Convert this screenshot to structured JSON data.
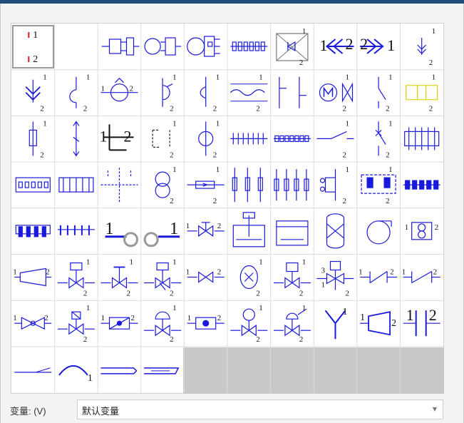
{
  "variable": {
    "label": "变量: (V)",
    "value": "默认变量"
  },
  "symbols": [
    {
      "name": "sym-connector-pins",
      "labels": [
        "1",
        "2"
      ]
    },
    {
      "name": "sym-empty",
      "labels": []
    },
    {
      "name": "sym-plug-socket",
      "labels": []
    },
    {
      "name": "sym-socket-circle",
      "labels": []
    },
    {
      "name": "sym-plug-multi",
      "labels": []
    },
    {
      "name": "sym-terminal-strip",
      "labels": []
    },
    {
      "name": "sym-diode-box",
      "labels": [
        "1",
        "2"
      ]
    },
    {
      "name": "sym-arrow-left",
      "labels": [
        "1",
        "2"
      ]
    },
    {
      "name": "sym-arrow-right",
      "labels": [
        "2",
        "1"
      ]
    },
    {
      "name": "sym-arrow-down-small",
      "labels": [
        "1",
        "2"
      ]
    },
    {
      "name": "sym-antenna-down",
      "labels": [
        "1",
        "2"
      ]
    },
    {
      "name": "sym-hook",
      "labels": [
        "1",
        "2"
      ]
    },
    {
      "name": "sym-sensor-circle",
      "labels": [
        "1",
        "2"
      ]
    },
    {
      "name": "sym-sensor-half",
      "labels": [
        "1",
        "2"
      ]
    },
    {
      "name": "sym-hook-line",
      "labels": [
        "1",
        "2"
      ]
    },
    {
      "name": "sym-wave-lines",
      "labels": [
        "1",
        "2"
      ]
    },
    {
      "name": "sym-bracket-lines",
      "labels": []
    },
    {
      "name": "sym-motor-valve",
      "labels": [
        "1",
        "2"
      ]
    },
    {
      "name": "sym-switch-slash",
      "labels": [
        "1",
        "2"
      ]
    },
    {
      "name": "sym-yellow-block",
      "labels": [
        "1",
        "2"
      ]
    },
    {
      "name": "sym-fuse-vertical",
      "labels": [
        "1",
        "2"
      ]
    },
    {
      "name": "sym-arrows-vertical",
      "labels": []
    },
    {
      "name": "sym-contact-big",
      "labels": [
        "1",
        "2"
      ]
    },
    {
      "name": "sym-dashed-contact",
      "labels": [
        "1",
        "2"
      ]
    },
    {
      "name": "sym-mcb-circle",
      "labels": [
        "1",
        "2"
      ]
    },
    {
      "name": "sym-terminal-row-a",
      "labels": []
    },
    {
      "name": "sym-terminal-row-b",
      "labels": []
    },
    {
      "name": "sym-switch-line",
      "labels": [
        "1",
        "2"
      ]
    },
    {
      "name": "sym-switch-x",
      "labels": [
        "1",
        "2"
      ]
    },
    {
      "name": "sym-terminal-box-a",
      "labels": []
    },
    {
      "name": "sym-terminal-box-b",
      "labels": []
    },
    {
      "name": "sym-terminal-box-c",
      "labels": []
    },
    {
      "name": "sym-dashed-cross",
      "labels": []
    },
    {
      "name": "sym-transformer",
      "labels": [
        "1",
        "2"
      ]
    },
    {
      "name": "sym-resistor-arrow",
      "labels": [
        "1",
        "2"
      ]
    },
    {
      "name": "sym-fuse-set-a",
      "labels": []
    },
    {
      "name": "sym-fuse-set-b",
      "labels": []
    },
    {
      "name": "sym-bracket-connector",
      "labels": [
        "1",
        "2"
      ]
    },
    {
      "name": "sym-relay-box",
      "labels": [
        "1",
        "2"
      ]
    },
    {
      "name": "sym-fuse-strip",
      "labels": []
    },
    {
      "name": "sym-fuse-strip-b",
      "labels": []
    },
    {
      "name": "sym-fuse-strip-c",
      "labels": []
    },
    {
      "name": "sym-pipe-ring-left",
      "labels": [
        "1"
      ]
    },
    {
      "name": "sym-pipe-ring-right",
      "labels": [
        "1"
      ]
    },
    {
      "name": "sym-valve-gate",
      "labels": [
        "1",
        "2"
      ]
    },
    {
      "name": "sym-tank-mixer",
      "labels": []
    },
    {
      "name": "sym-tank-open",
      "labels": []
    },
    {
      "name": "sym-column-vessel",
      "labels": []
    },
    {
      "name": "sym-pump-centrifugal",
      "labels": []
    },
    {
      "name": "sym-eight-box",
      "labels": [
        "1",
        "2"
      ]
    },
    {
      "name": "sym-reducer",
      "labels": [
        "1",
        "2"
      ]
    },
    {
      "name": "sym-valve-actuator-box",
      "labels": [
        "1",
        "2"
      ]
    },
    {
      "name": "sym-valve-t-handle",
      "labels": [
        "1",
        "2"
      ]
    },
    {
      "name": "sym-valve-diaphragm",
      "labels": [
        "1",
        "2"
      ]
    },
    {
      "name": "sym-valve-inline",
      "labels": [
        "1",
        "2"
      ]
    },
    {
      "name": "sym-ellipse-x",
      "labels": [
        "1",
        "2"
      ]
    },
    {
      "name": "sym-valve-solenoid",
      "labels": [
        "1",
        "2"
      ]
    },
    {
      "name": "sym-valve-3way-s",
      "labels": [
        "3",
        "1",
        "2"
      ]
    },
    {
      "name": "sym-valve-check",
      "labels": [
        "1",
        "2"
      ]
    },
    {
      "name": "sym-valve-butterfly",
      "labels": [
        "1",
        "2"
      ]
    },
    {
      "name": "sym-valve-bowtie",
      "labels": [
        "1",
        "2"
      ]
    },
    {
      "name": "sym-valve-solenoid-b",
      "labels": [
        "1",
        "2"
      ]
    },
    {
      "name": "sym-box-slash",
      "labels": [
        "1",
        "2"
      ]
    },
    {
      "name": "sym-valve-dome",
      "labels": [
        "1",
        "2"
      ]
    },
    {
      "name": "sym-box-dot",
      "labels": [
        "1",
        "2"
      ]
    },
    {
      "name": "sym-valve-motor-m",
      "labels": [
        "1",
        "2"
      ]
    },
    {
      "name": "sym-valve-dome-b",
      "labels": [
        "1",
        "2"
      ]
    },
    {
      "name": "sym-y-branch",
      "labels": [
        "1"
      ]
    },
    {
      "name": "sym-trapezoid",
      "labels": [
        "1",
        "2"
      ]
    },
    {
      "name": "sym-capacitor",
      "labels": [
        "1",
        "2"
      ]
    },
    {
      "name": "sym-line-ramp",
      "labels": []
    },
    {
      "name": "sym-arc-line",
      "labels": [
        "1"
      ]
    },
    {
      "name": "sym-pipe-flat",
      "labels": []
    },
    {
      "name": "sym-pipe-slant",
      "labels": []
    }
  ]
}
